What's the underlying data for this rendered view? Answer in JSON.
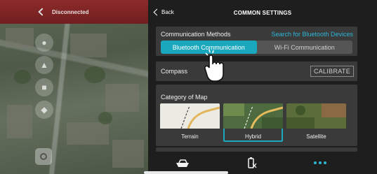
{
  "map_panel": {
    "status_text": "Disconnected"
  },
  "header": {
    "back_label": "Back",
    "title": "COMMON SETTINGS"
  },
  "communication": {
    "label": "Communication Methods",
    "search_link": "Search for Bluetooth Devices",
    "options": [
      {
        "label": "Bluetooth Communication",
        "selected": true
      },
      {
        "label": "Wi-Fi Communication",
        "selected": false
      }
    ]
  },
  "compass": {
    "label": "Compass",
    "calibrate_label": "CALIBRATE"
  },
  "map_category": {
    "label": "Category of Map",
    "options": [
      {
        "label": "Terrain",
        "selected": false
      },
      {
        "label": "Hybrid",
        "selected": true
      },
      {
        "label": "Satellite",
        "selected": false
      }
    ]
  },
  "bottom_nav": {
    "items": [
      "boat-icon",
      "battery-icon",
      "more-icon"
    ]
  },
  "colors": {
    "accent": "#19a8be",
    "link": "#2bb7d6",
    "status_bar": "#7a2323",
    "panel_bg": "#1e1e1e",
    "card_bg": "#3a3a3a"
  }
}
